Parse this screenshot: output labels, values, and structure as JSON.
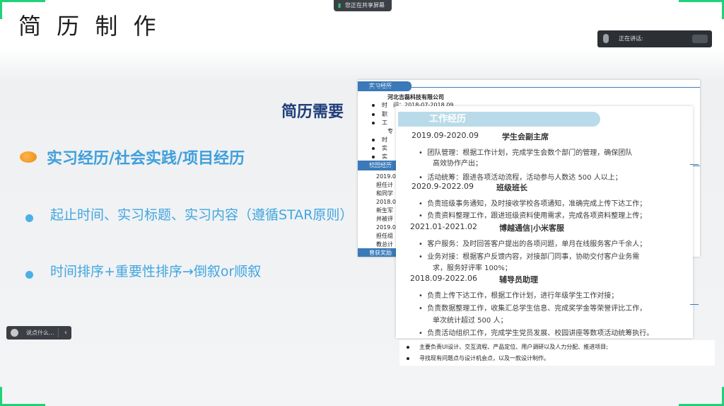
{
  "slide": {
    "title": "简 历 制 作",
    "section_heading": "实习经历/社会实践/项目经历",
    "bullets": [
      "起止时间、实习标题、实习内容（遵循STAR原则）",
      "时间排序+重要性排序→倒叙or顺叙"
    ],
    "resume_heading": "简历需要"
  },
  "meeting": {
    "sharing_label": "您正在共享屏幕",
    "speaking_label": "正在讲话:",
    "chat_placeholder": "说点什么...",
    "chat_collapse_icon": "chevron-left-icon",
    "accent_color": "#1fd27a"
  },
  "back_resume": {
    "tab_internship": "实习经历",
    "company": "河北吉磊科技有限公司",
    "rows": [
      "时　间：2018-07-2018.09",
      "职",
      "工",
      "专",
      "时",
      "实",
      "实"
    ],
    "tab_campus": "校园经历",
    "campus_rows": [
      "2019.0",
      "担任计",
      "和同学",
      "2018.0",
      "新生军",
      "并被评",
      "2019.0",
      "担任组",
      "教总计"
    ],
    "tab_awards": "曾获奖励"
  },
  "front_resume": {
    "header": "工作经历",
    "entries": [
      {
        "date": "2019.09-2020.09",
        "role": "学生会副主席",
        "items": [
          "团队管理：根据工作计划，完成学生会数个部门的管理，确保团队",
          "高效协作产出；",
          "活动统筹：跟进各项活动流程，活动参与人数达 500 人以上；"
        ]
      },
      {
        "date": "2020.9-2022.09",
        "role": "班级班长",
        "items": [
          "负责班级事务通知，及时接收学校各项通知，准确完成上传下达工作；",
          "负责资料整理工作，跟进班级资料使用需求，完成各项资料整理上传；"
        ]
      },
      {
        "date": "2021.01-2021.02",
        "role": "博越通信|小米客服",
        "items": [
          "客户服务：及时回答客户提出的各项问题，单月在线服务客户千余人；",
          "业务对接：根据客户反馈内容，对接部门同事，协助交付客户业务需",
          "求，服务好评率 100%；"
        ]
      },
      {
        "date": "2018.09-2022.06",
        "role": "辅导员助理",
        "items": [
          "负责上传下达工作，根据工作计划，进行年级学生工作对接；",
          "负责数据整理工作，收集汇总学生信息、完成奖学金等荣誉评比工作，",
          "单次统计超过 500 人；",
          "负责活动组织工作，完成学生党员发展、校园讲座等数项活动统筹执行。"
        ]
      }
    ]
  },
  "bottom_strip": [
    "主要负责UI设计、交互流程、产品定位、用户调研以及人力分配、推进项目;",
    "寻找现有问题点与设计机会点，以及一款设计制作。"
  ]
}
